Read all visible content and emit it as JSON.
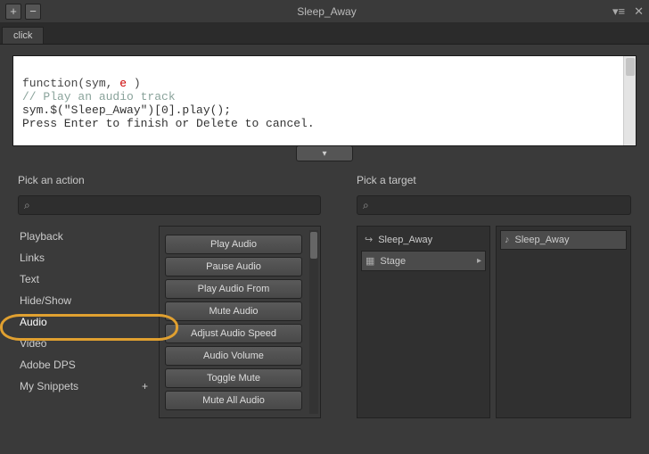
{
  "titlebar": {
    "add": "+",
    "remove": "−",
    "title": "Sleep_Away",
    "menu": "▾≡",
    "close": "✕"
  },
  "tab": {
    "label": "click"
  },
  "code": {
    "line1_a": "function(sym, ",
    "line1_b": "e",
    "line1_c": " )",
    "line2": "// Play an audio track",
    "line3": "sym.$(\"Sleep_Away\")[0].play();",
    "line4": "Press Enter to finish or Delete to cancel."
  },
  "chevron": "▾",
  "pick_action": {
    "heading": "Pick an action",
    "search_placeholder": "",
    "categories": [
      "Playback",
      "Links",
      "Text",
      "Hide/Show",
      "Audio",
      "Video",
      "Adobe DPS",
      "My Snippets"
    ],
    "snippets_plus": "+",
    "actions": [
      "Play Audio",
      "Pause Audio",
      "Play Audio From",
      "Mute Audio",
      "Adjust Audio Speed",
      "Audio Volume",
      "Toggle Mute",
      "Mute All Audio"
    ]
  },
  "pick_target": {
    "heading": "Pick a target",
    "items": [
      {
        "icon": "↪",
        "label": "Sleep_Away"
      },
      {
        "icon": "▦",
        "label": "Stage",
        "hasChildren": true,
        "selected": true
      }
    ],
    "sub": [
      {
        "icon": "♪",
        "label": "Sleep_Away",
        "selected": true
      }
    ]
  }
}
